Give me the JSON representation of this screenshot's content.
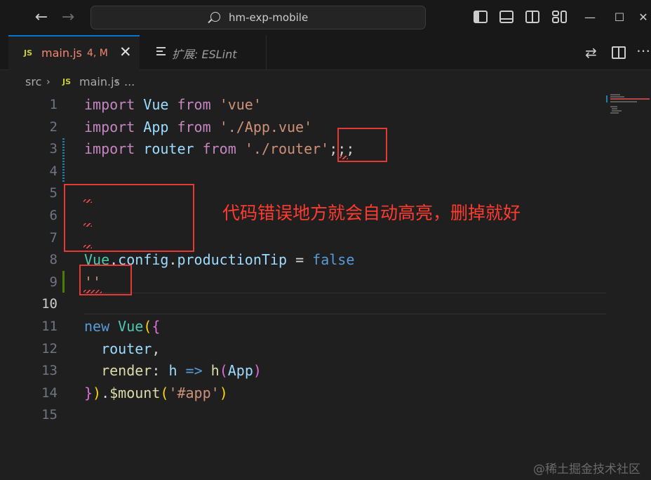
{
  "titlebar": {
    "command_center": "hm-exp-mobile"
  },
  "tabs": [
    {
      "badge": "JS",
      "label": "main.js",
      "status": "4, M",
      "active": true
    },
    {
      "label": "扩展: ESLint",
      "active": false
    }
  ],
  "breadcrumb": {
    "folder": "src",
    "badge": "JS",
    "file": "main.js",
    "more": "..."
  },
  "editor": {
    "line_numbers": [
      "1",
      "2",
      "3",
      "4",
      "5",
      "6",
      "7",
      "8",
      "9",
      "10",
      "11",
      "12",
      "13",
      "14",
      "15"
    ],
    "active_line": "10"
  },
  "annotation": {
    "text": "代码错误地方就会自动高亮，删掉就好"
  },
  "watermark": {
    "text": "@稀土掘金技术社区"
  },
  "colors": {
    "keyword": "#569cd6",
    "string": "#ce9178",
    "identifier": "#9cdcfe",
    "error": "#f14c4c",
    "annotation": "#ff3b30",
    "accent": "#0078d4"
  }
}
